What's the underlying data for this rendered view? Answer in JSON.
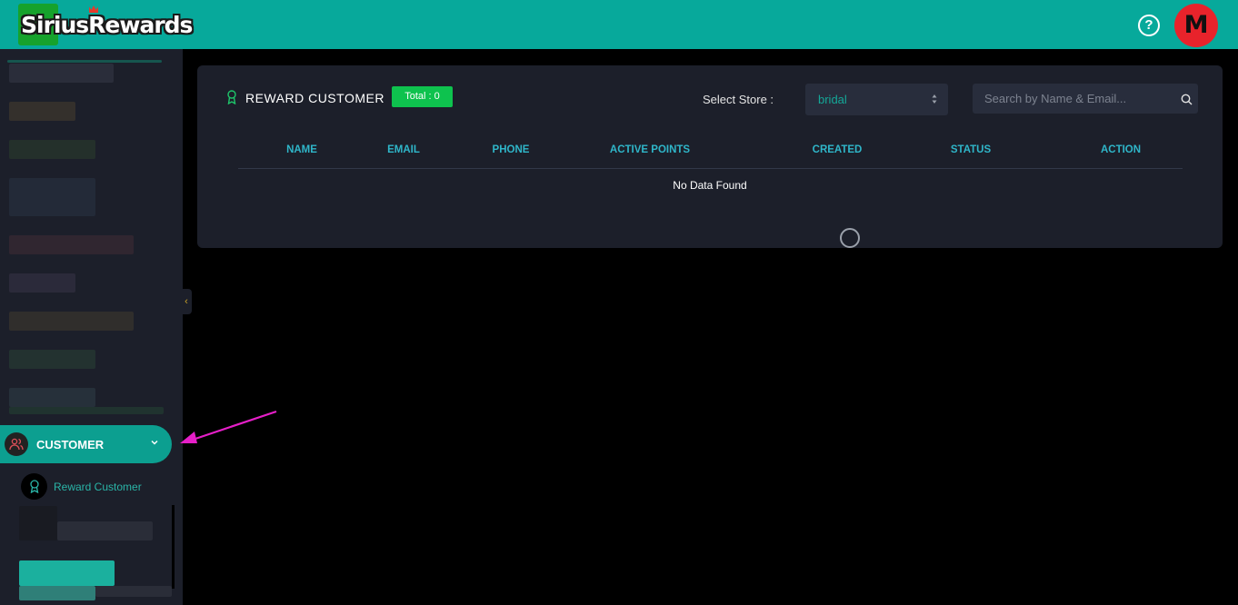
{
  "app": {
    "logo_text": "SiriusRewards"
  },
  "header": {
    "help_icon": "question-circle-icon",
    "avatar_initial": "M"
  },
  "sidebar": {
    "active_item": {
      "label": "CUSTOMER",
      "icon": "users-icon",
      "chevron": "chevron-down-icon"
    },
    "sub_items": [
      {
        "label": "Reward Customer",
        "icon": "award-icon"
      }
    ],
    "collapse_glyph": "‹"
  },
  "main": {
    "title": "REWARD CUSTOMER",
    "total_badge": "Total : 0",
    "store_filter": {
      "label": "Select Store :",
      "value": "bridal"
    },
    "search": {
      "placeholder": "Search by Name & Email..."
    },
    "table": {
      "columns": [
        "NAME",
        "EMAIL",
        "PHONE",
        "ACTIVE POINTS",
        "CREATED",
        "STATUS",
        "ACTION"
      ],
      "empty_text": "No Data Found"
    }
  },
  "colors": {
    "header": "#07a99b",
    "sidebar": "#1c1f2a",
    "accent": "#0c9f90",
    "badge": "#0ec24e",
    "column_header": "#2fb6c9",
    "annotation_arrow": "#e61fc8"
  }
}
